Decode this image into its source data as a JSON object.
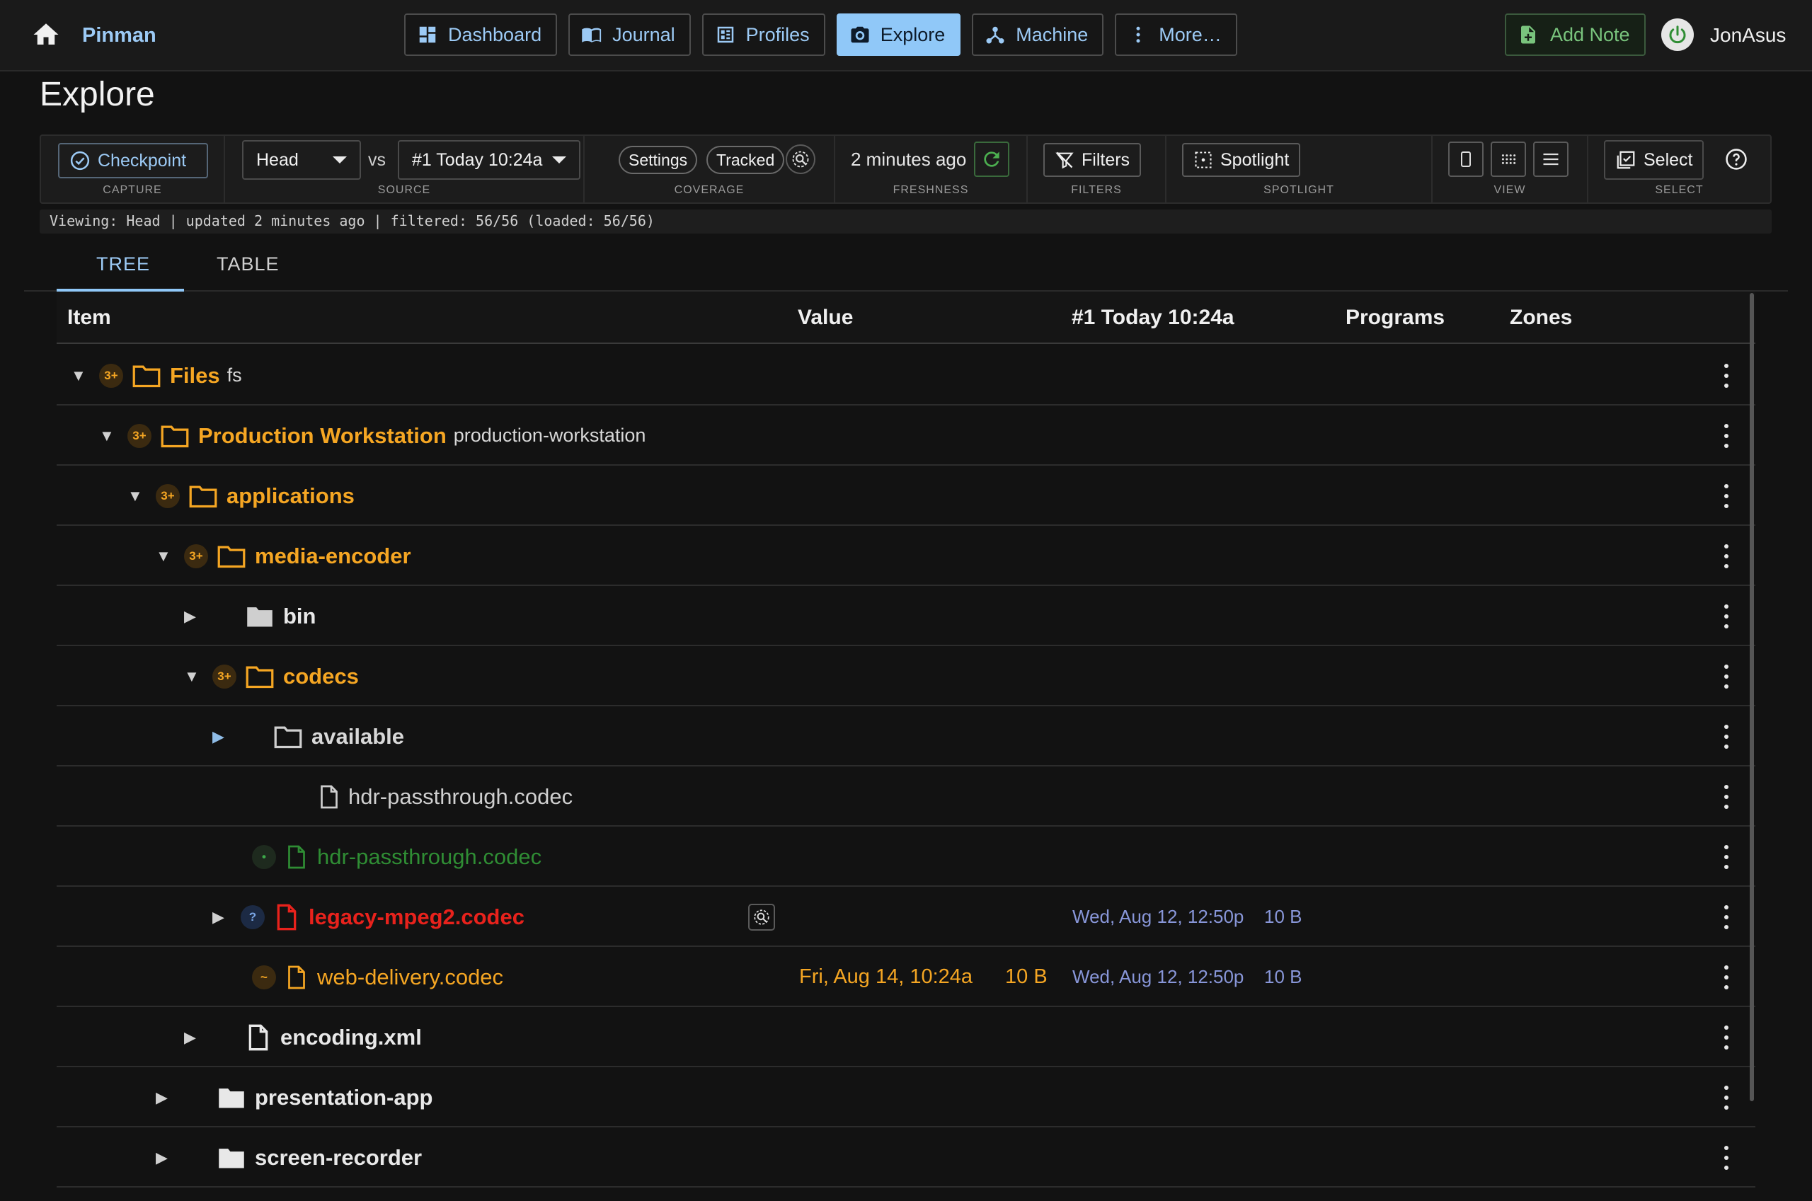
{
  "app": {
    "name": "Pinman",
    "user": "JonAsus"
  },
  "nav": [
    {
      "label": "Dashboard",
      "icon": "dashboard-icon"
    },
    {
      "label": "Journal",
      "icon": "book-icon"
    },
    {
      "label": "Profiles",
      "icon": "profiles-icon"
    },
    {
      "label": "Explore",
      "icon": "camera-icon",
      "active": true
    },
    {
      "label": "Machine",
      "icon": "network-icon"
    },
    {
      "label": "More…",
      "icon": "more-vertical-icon"
    }
  ],
  "add_note_label": "Add Note",
  "page_title": "Explore",
  "toolbar": {
    "checkpoint_label": "Checkpoint",
    "capture_caption": "CAPTURE",
    "source_left": "Head",
    "vs_label": "vs",
    "source_right": "#1 Today 10:24a",
    "source_caption": "SOURCE",
    "settings_label": "Settings",
    "tracked_label": "Tracked",
    "coverage_caption": "COVERAGE",
    "freshness_value": "2 minutes ago",
    "freshness_caption": "FRESHNESS",
    "filters_label": "Filters",
    "filters_caption": "FILTERS",
    "spotlight_label": "Spotlight",
    "spotlight_caption": "SPOTLIGHT",
    "view_caption": "VIEW",
    "select_label": "Select",
    "select_caption": "SELECT"
  },
  "status_line": "Viewing: Head | updated 2 minutes ago | filtered: 56/56 (loaded: 56/56)",
  "tabs": [
    "TREE",
    "TABLE"
  ],
  "columns": [
    "Item",
    "Value",
    "#1 Today 10:24a",
    "Programs",
    "Zones"
  ],
  "rows": [
    {
      "name": "Files",
      "sub": "fs"
    },
    {
      "name": "Production Workstation",
      "sub": "production-workstation"
    },
    {
      "name": "applications"
    },
    {
      "name": "media-encoder"
    },
    {
      "name": "bin"
    },
    {
      "name": "codecs"
    },
    {
      "name": "available"
    },
    {
      "name": "hdr-passthrough.codec"
    },
    {
      "name": "hdr-passthrough.codec"
    },
    {
      "name": "legacy-mpeg2.codec",
      "snapshot_date": "Wed, Aug 12, 12:50p",
      "snapshot_size": "10 B"
    },
    {
      "name": "web-delivery.codec",
      "value_date": "Fri, Aug 14, 10:24a",
      "value_size": "10 B",
      "snapshot_date": "Wed, Aug 12, 12:50p",
      "snapshot_size": "10 B"
    },
    {
      "name": "encoding.xml"
    },
    {
      "name": "presentation-app"
    },
    {
      "name": "screen-recorder"
    }
  ],
  "badges": {
    "plus": "3+",
    "question": "?",
    "dot": "•",
    "tilde": "~"
  },
  "colors": {
    "accent": "#90c8f8",
    "folder_orange": "#f5a623",
    "added_green": "#2f8d34",
    "removed_red": "#e8221c",
    "snapshot_blue": "#8896d8"
  }
}
